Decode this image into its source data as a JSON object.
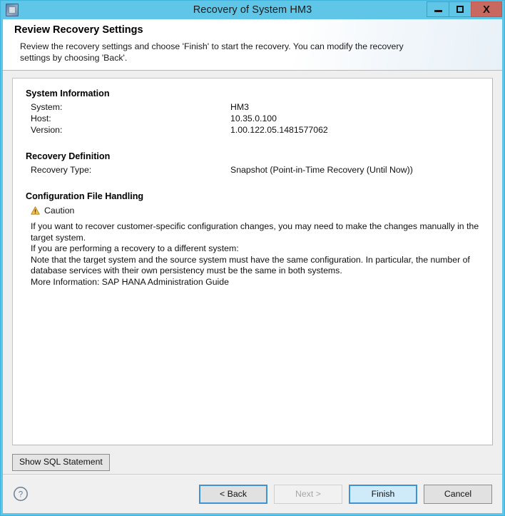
{
  "window": {
    "title": "Recovery of System HM3",
    "app_icon": "application-icon",
    "controls": {
      "minimize": "minimize-icon",
      "maximize": "maximize-icon",
      "close": "X"
    }
  },
  "header": {
    "title": "Review Recovery Settings",
    "description": "Review the recovery settings and choose 'Finish' to start the recovery. You can modify the recovery settings by choosing 'Back'."
  },
  "sections": {
    "system_information": {
      "title": "System Information",
      "rows": [
        {
          "label": "System:",
          "value": "HM3"
        },
        {
          "label": "Host:",
          "value": "10.35.0.100"
        },
        {
          "label": "Version:",
          "value": "1.00.122.05.1481577062"
        }
      ]
    },
    "recovery_definition": {
      "title": "Recovery Definition",
      "rows": [
        {
          "label": "Recovery Type:",
          "value": "Snapshot (Point-in-Time Recovery (Until Now))"
        }
      ]
    },
    "configuration_file_handling": {
      "title": "Configuration File Handling",
      "caution_icon": "warning-triangle-icon",
      "caution_label": "Caution",
      "paragraphs": [
        "If you want to recover customer-specific configuration changes, you may need to make the changes manually in the target system.",
        "If you are performing a recovery to a different system:",
        "Note that the target system and the source system must have the same configuration. In particular, the number of database services with their own persistency must be the same in both systems.",
        "More Information: SAP HANA Administration Guide"
      ]
    }
  },
  "toolbar": {
    "show_sql_label": "Show SQL Statement"
  },
  "footer": {
    "help_icon": "help-question-icon",
    "back_label": "< Back",
    "next_label": "Next >",
    "finish_label": "Finish",
    "cancel_label": "Cancel"
  },
  "colors": {
    "window_chrome": "#60c6e8",
    "close_button": "#c9685f",
    "primary_button": "#cfeaf9",
    "primary_button_border": "#3f93d4",
    "caution": "#e0a020"
  }
}
